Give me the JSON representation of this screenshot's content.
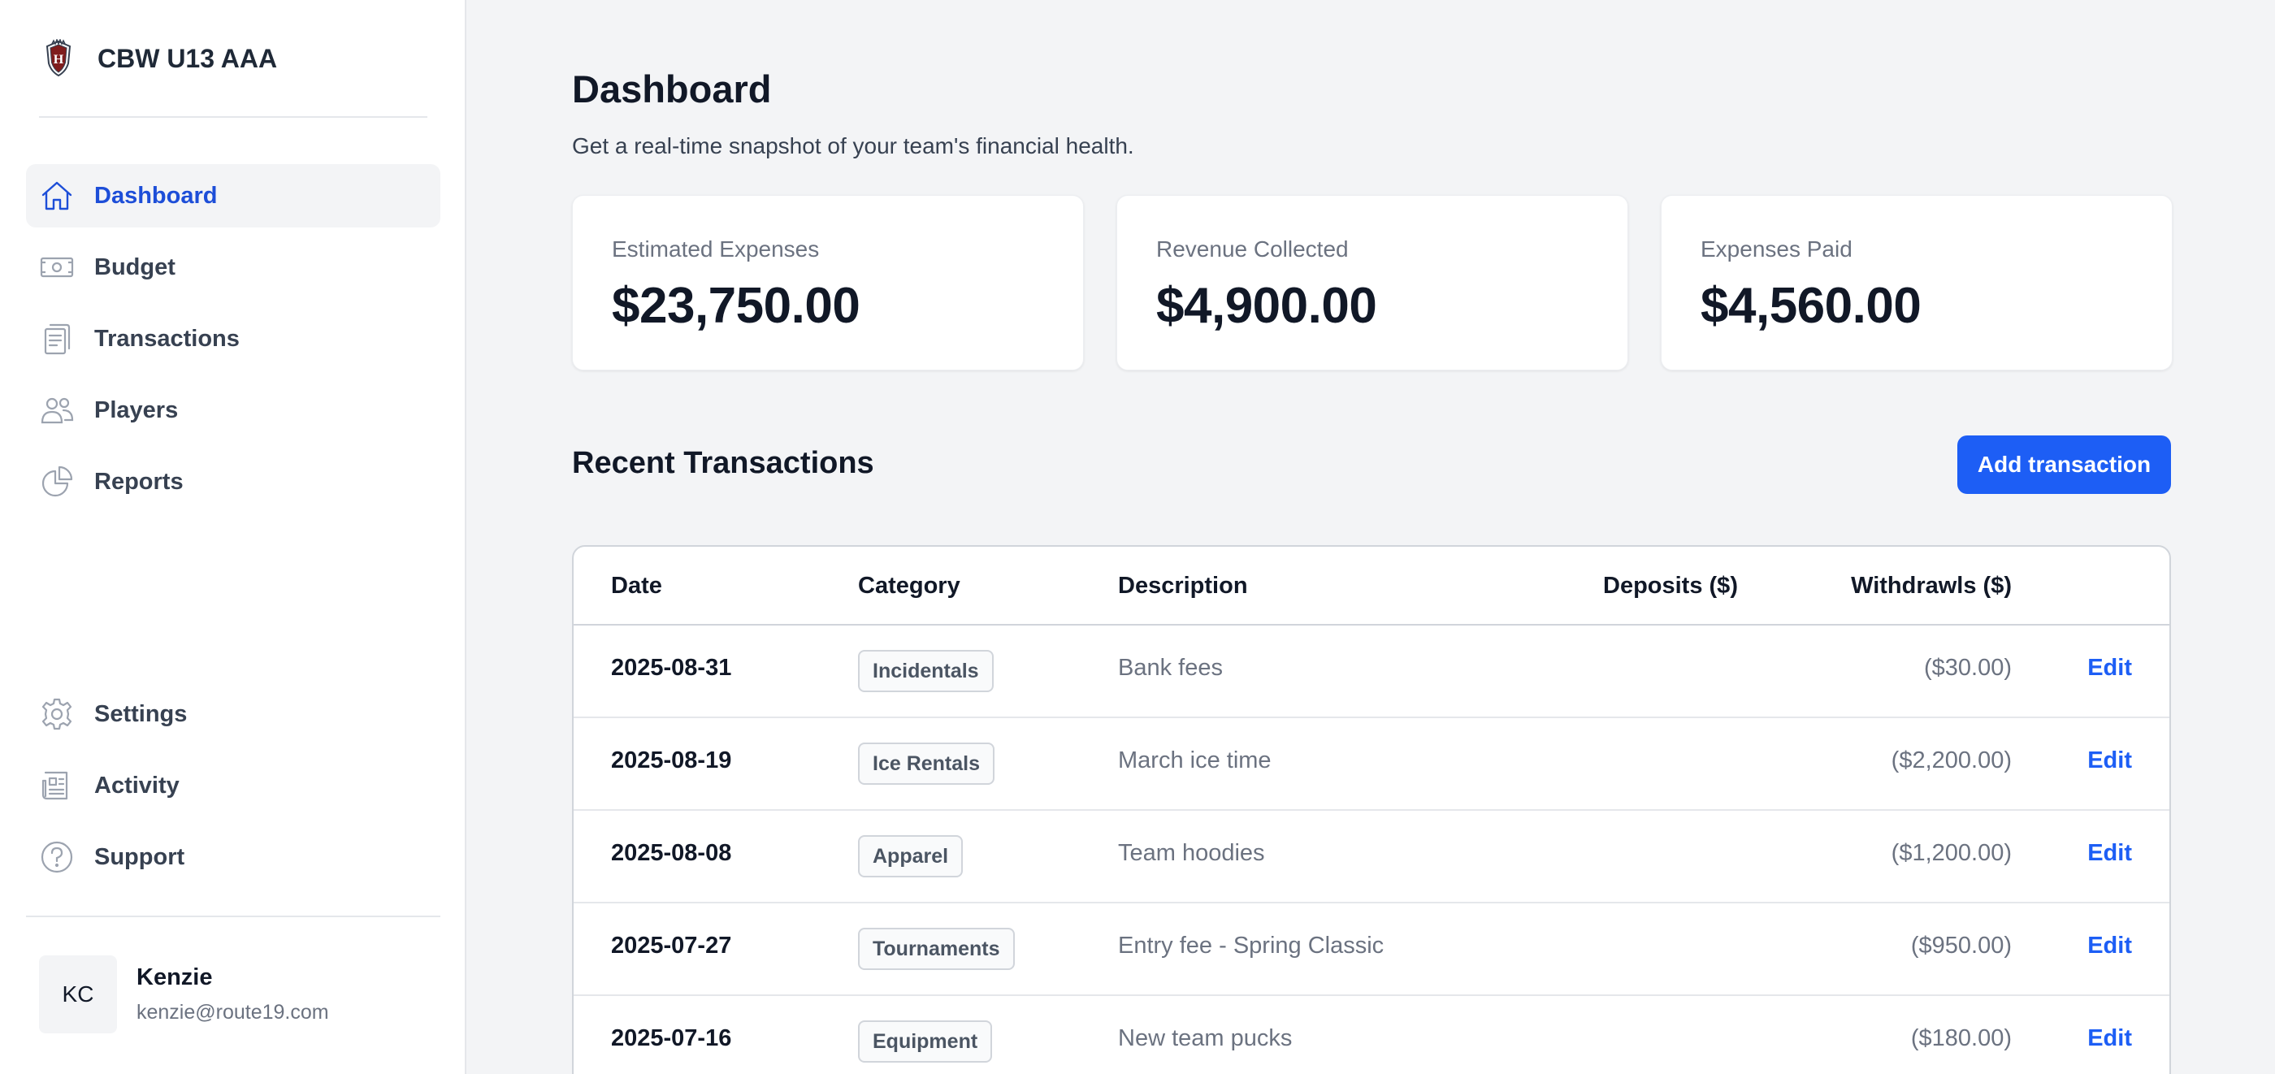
{
  "brand": {
    "name": "CBW U13 AAA",
    "logo_icon": "team-crest-icon"
  },
  "nav": {
    "top": [
      {
        "label": "Dashboard",
        "icon": "home-icon",
        "active": true
      },
      {
        "label": "Budget",
        "icon": "cash-icon",
        "active": false
      },
      {
        "label": "Transactions",
        "icon": "clipboard-icon",
        "active": false
      },
      {
        "label": "Players",
        "icon": "users-icon",
        "active": false
      },
      {
        "label": "Reports",
        "icon": "pie-chart-icon",
        "active": false
      }
    ],
    "bottom": [
      {
        "label": "Settings",
        "icon": "gear-icon"
      },
      {
        "label": "Activity",
        "icon": "newspaper-icon"
      },
      {
        "label": "Support",
        "icon": "question-icon"
      }
    ]
  },
  "user": {
    "initials": "KC",
    "name": "Kenzie",
    "email": "kenzie@route19.com"
  },
  "page": {
    "title": "Dashboard",
    "subtitle": "Get a real-time snapshot of your team's financial health."
  },
  "stats": [
    {
      "label": "Estimated Expenses",
      "value": "$23,750.00"
    },
    {
      "label": "Revenue Collected",
      "value": "$4,900.00"
    },
    {
      "label": "Expenses Paid",
      "value": "$4,560.00"
    }
  ],
  "transactions": {
    "title": "Recent Transactions",
    "add_label": "Add transaction",
    "columns": {
      "date": "Date",
      "category": "Category",
      "description": "Description",
      "deposits": "Deposits ($)",
      "withdrawals": "Withdrawls ($)"
    },
    "edit_label": "Edit",
    "rows": [
      {
        "date": "2025-08-31",
        "category": "Incidentals",
        "description": "Bank fees",
        "deposit": "",
        "withdrawal": "($30.00)"
      },
      {
        "date": "2025-08-19",
        "category": "Ice Rentals",
        "description": "March ice time",
        "deposit": "",
        "withdrawal": "($2,200.00)"
      },
      {
        "date": "2025-08-08",
        "category": "Apparel",
        "description": "Team hoodies",
        "deposit": "",
        "withdrawal": "($1,200.00)"
      },
      {
        "date": "2025-07-27",
        "category": "Tournaments",
        "description": "Entry fee - Spring Classic",
        "deposit": "",
        "withdrawal": "($950.00)"
      },
      {
        "date": "2025-07-16",
        "category": "Equipment",
        "description": "New team pucks",
        "deposit": "",
        "withdrawal": "($180.00)"
      }
    ]
  },
  "colors": {
    "accent": "#1d5ef5",
    "active_nav": "#1d4ed8",
    "background": "#f3f4f6"
  }
}
